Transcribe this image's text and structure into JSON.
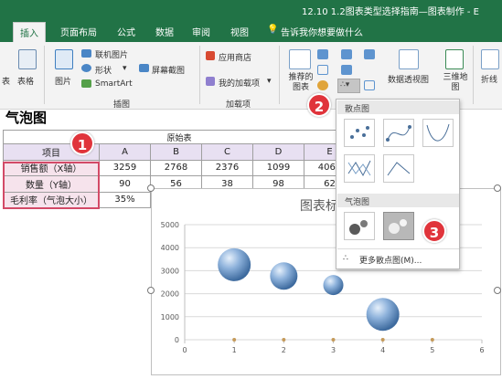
{
  "window": {
    "title": "12.10 1.2图表类型选择指南—图表制作 - E"
  },
  "tabs": [
    "插入",
    "页面布局",
    "公式",
    "数据",
    "审阅",
    "视图"
  ],
  "tell_me": "告诉我你想要做什么",
  "ribbon": {
    "tables": {
      "cut_label": "表",
      "label": "表格"
    },
    "illustrations": {
      "pictures": "图片",
      "online_pictures": "联机图片",
      "shapes": "形状",
      "smartart": "SmartArt",
      "screenshot": "屏幕截图",
      "group": "插图"
    },
    "addins": {
      "store": "应用商店",
      "my_addins": "我的加载项",
      "group": "加载项"
    },
    "charts": {
      "recommended": "推荐的图表",
      "pivot": "数据透视图",
      "map3d": "三维地图",
      "line_sparkline": "折线"
    }
  },
  "sheet": {
    "title": "气泡图",
    "table_title": "原始表",
    "headers": [
      "项目",
      "A",
      "B",
      "C",
      "D",
      "E"
    ],
    "rows": [
      [
        "销售额（X轴）",
        "3259",
        "2768",
        "2376",
        "1099",
        "4069"
      ],
      [
        "数量（Y轴）",
        "90",
        "56",
        "38",
        "98",
        "62"
      ],
      [
        "毛利率（气泡大小）",
        "35%",
        "",
        "",
        "",
        ""
      ]
    ]
  },
  "dropdown": {
    "scatter_header": "散点图",
    "bubble_header": "气泡图",
    "more": "更多散点图(M)..."
  },
  "badges": [
    "1",
    "2",
    "3"
  ],
  "chart": {
    "title": "图表标题",
    "y_ticks": [
      "5000",
      "4000",
      "3000",
      "2000",
      "1000",
      "0"
    ],
    "x_ticks": [
      "0",
      "1",
      "2",
      "3",
      "4",
      "5",
      "6"
    ]
  },
  "chart_data": {
    "type": "scatter",
    "title": "图表标题",
    "xlim": [
      0,
      6
    ],
    "ylim": [
      0,
      5000
    ],
    "bubbles": [
      {
        "x": 1,
        "y": 3259,
        "size": "large"
      },
      {
        "x": 2,
        "y": 2768,
        "size": "medium"
      },
      {
        "x": 3,
        "y": 2376,
        "size": "small"
      },
      {
        "x": 4,
        "y": 1099,
        "size": "large"
      }
    ],
    "baseline_points": [
      {
        "x": 1,
        "y": 0
      },
      {
        "x": 2,
        "y": 0
      },
      {
        "x": 3,
        "y": 0
      },
      {
        "x": 4,
        "y": 0
      },
      {
        "x": 5,
        "y": 0
      }
    ],
    "grid": "horizontal"
  },
  "colors": {
    "accent": "#217346",
    "badge": "#e0343b",
    "bubble": "#5a86b8",
    "selection": "#d34a67"
  }
}
